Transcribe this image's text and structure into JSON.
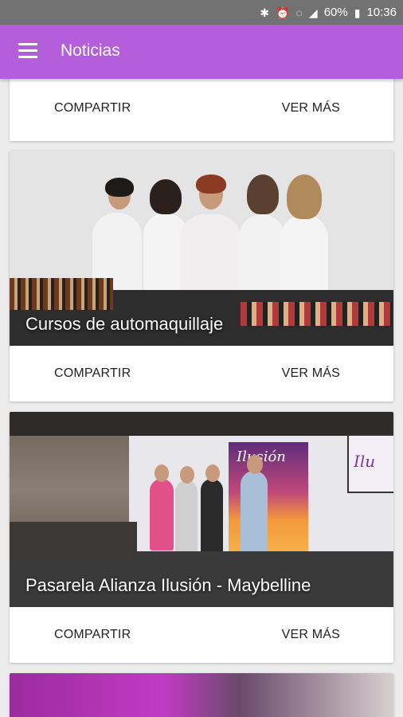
{
  "status_bar": {
    "battery": "60%",
    "time": "10:36",
    "icons": [
      "bluetooth-icon",
      "alarm-icon",
      "wifi-icon",
      "signal-icon",
      "battery-icon"
    ]
  },
  "app_bar": {
    "title": "Noticias",
    "color": "#b45edc"
  },
  "cards": [
    {
      "caption": "",
      "share_label": "COMPARTIR",
      "more_label": "VER MÁS"
    },
    {
      "caption": "Cursos de automaquillaje",
      "share_label": "COMPARTIR",
      "more_label": "VER MÁS"
    },
    {
      "caption": "Pasarela Alianza Ilusión - Maybelline",
      "share_label": "COMPARTIR",
      "more_label": "VER MÁS"
    },
    {
      "caption": ""
    }
  ],
  "poster_text": "Ilusión",
  "screen_text": "Ilu"
}
